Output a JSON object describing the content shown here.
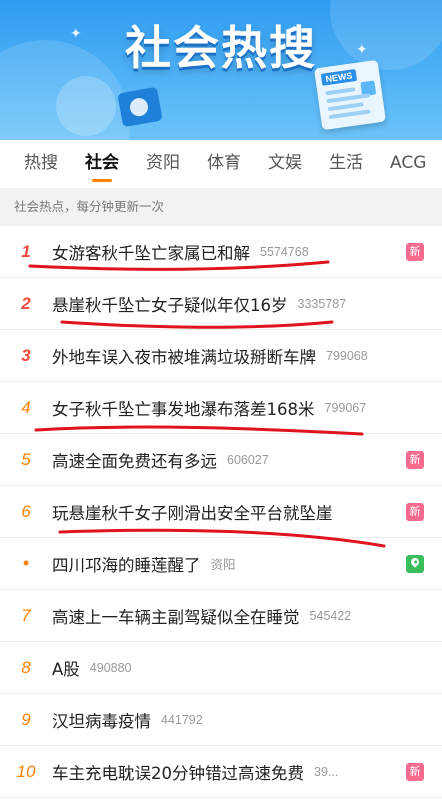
{
  "banner": {
    "title": "社会热搜",
    "news_tag": "NEWS",
    "illustration_icons": [
      "newspaper-icon",
      "pie-chart-icon"
    ]
  },
  "tabs": [
    {
      "label": "热搜",
      "active": false
    },
    {
      "label": "社会",
      "active": true
    },
    {
      "label": "资阳",
      "active": false
    },
    {
      "label": "体育",
      "active": false
    },
    {
      "label": "文娱",
      "active": false
    },
    {
      "label": "生活",
      "active": false
    },
    {
      "label": "ACG",
      "active": false
    }
  ],
  "info_text": "社会热点，每分钟更新一次",
  "items": [
    {
      "rank": "1",
      "title": "女游客秋千坠亡家属已和解",
      "hot": "5574768",
      "badge": "新",
      "badge_type": "new",
      "top": true
    },
    {
      "rank": "2",
      "title": "悬崖秋千坠亡女子疑似年仅16岁",
      "hot": "3335787",
      "badge": "",
      "badge_type": "",
      "top": true
    },
    {
      "rank": "3",
      "title": "外地车误入夜市被堆满垃圾掰断车牌",
      "hot": "799068",
      "badge": "",
      "badge_type": "",
      "top": true
    },
    {
      "rank": "4",
      "title": "女子秋千坠亡事发地瀑布落差168米",
      "hot": "799067",
      "badge": "",
      "badge_type": "",
      "top": false
    },
    {
      "rank": "5",
      "title": "高速全面免费还有多远",
      "hot": "606027",
      "badge": "新",
      "badge_type": "new",
      "top": false
    },
    {
      "rank": "6",
      "title": "玩悬崖秋千女子刚滑出安全平台就坠崖",
      "hot": "",
      "badge": "新",
      "badge_type": "new",
      "top": false
    },
    {
      "rank": "•",
      "title": "四川邛海的睡莲醒了",
      "hot": "资阳",
      "badge": "",
      "badge_type": "location",
      "top": false
    },
    {
      "rank": "7",
      "title": "高速上一车辆主副驾疑似全在睡觉",
      "hot": "545422",
      "badge": "",
      "badge_type": "",
      "top": false
    },
    {
      "rank": "8",
      "title": "A股",
      "hot": "490880",
      "badge": "",
      "badge_type": "",
      "top": false
    },
    {
      "rank": "9",
      "title": "汉坦病毒疫情",
      "hot": "441792",
      "badge": "",
      "badge_type": "",
      "top": false
    },
    {
      "rank": "10",
      "title": "车主充电耽误20分钟错过高速免费",
      "hot": "39...",
      "badge": "新",
      "badge_type": "new",
      "top": false
    }
  ],
  "colors": {
    "banner_top": "#2f9bf0",
    "rank_top": "#f24c3d",
    "rank_normal": "#ff8200",
    "tab_indicator": "#ff8200",
    "badge_new": "#f86a8e",
    "badge_location": "#3cbd5c",
    "annotation_underline": "#e0141e"
  }
}
